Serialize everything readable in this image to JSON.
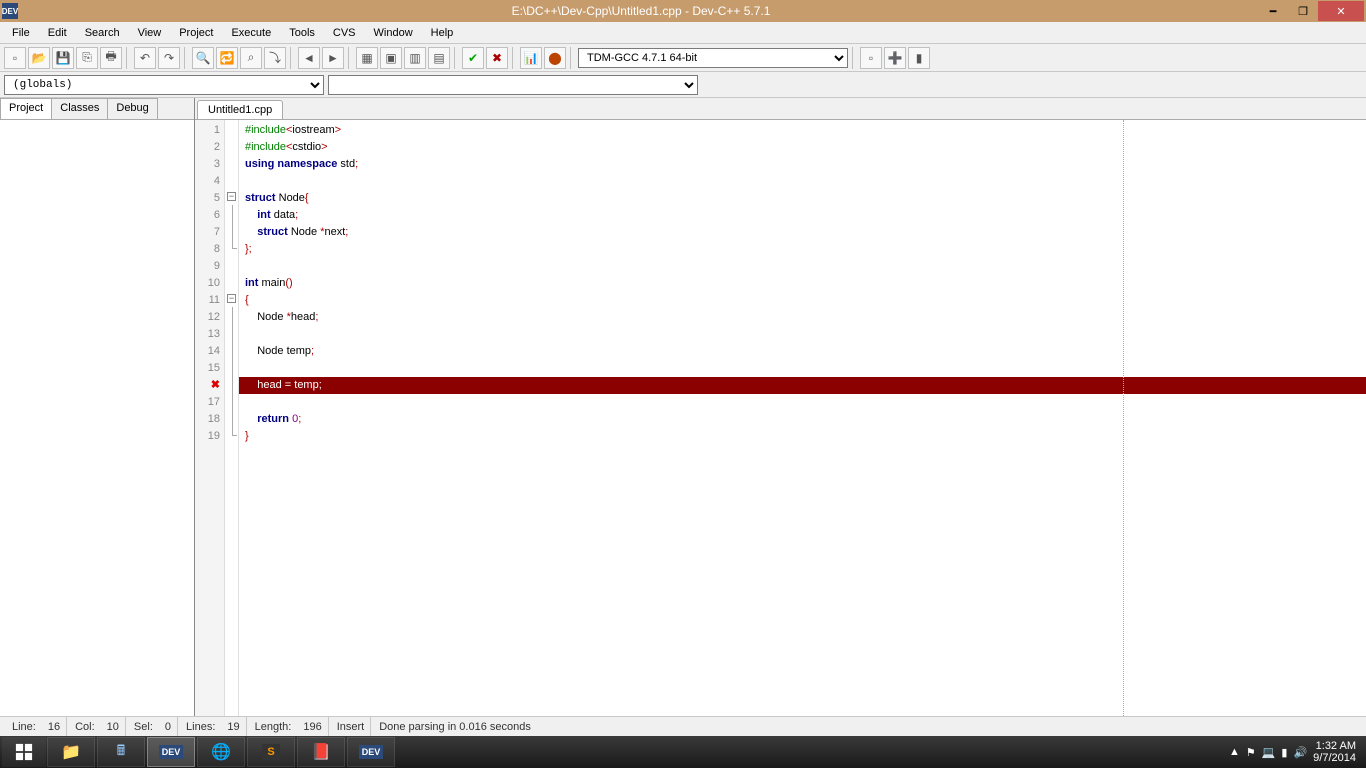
{
  "title": "E:\\DC++\\Dev-Cpp\\Untitled1.cpp - Dev-C++ 5.7.1",
  "menu": [
    "File",
    "Edit",
    "Search",
    "View",
    "Project",
    "Execute",
    "Tools",
    "CVS",
    "Window",
    "Help"
  ],
  "compiler": "TDM-GCC 4.7.1 64-bit",
  "scope": "(globals)",
  "sidetabs": [
    "Project",
    "Classes",
    "Debug"
  ],
  "filetab": "Untitled1.cpp",
  "code": {
    "lines": [
      {
        "n": "1",
        "t": [
          [
            "kw-green",
            "#include"
          ],
          [
            "sym",
            "<"
          ],
          [
            "plain",
            "iostream"
          ],
          [
            "sym",
            ">"
          ]
        ]
      },
      {
        "n": "2",
        "t": [
          [
            "kw-green",
            "#include"
          ],
          [
            "sym",
            "<"
          ],
          [
            "plain",
            "cstdio"
          ],
          [
            "sym",
            ">"
          ]
        ]
      },
      {
        "n": "3",
        "t": [
          [
            "kw-blue",
            "using"
          ],
          [
            "plain",
            " "
          ],
          [
            "kw-blue",
            "namespace"
          ],
          [
            "plain",
            " std"
          ],
          [
            "sym",
            ";"
          ]
        ]
      },
      {
        "n": "4",
        "t": []
      },
      {
        "n": "5",
        "t": [
          [
            "kw-blue",
            "struct"
          ],
          [
            "plain",
            " Node"
          ],
          [
            "sym",
            "{"
          ]
        ],
        "fold": "open"
      },
      {
        "n": "6",
        "t": [
          [
            "plain",
            "    "
          ],
          [
            "kw-blue",
            "int"
          ],
          [
            "plain",
            " data"
          ],
          [
            "sym",
            ";"
          ]
        ],
        "fold": "line"
      },
      {
        "n": "7",
        "t": [
          [
            "plain",
            "    "
          ],
          [
            "kw-blue",
            "struct"
          ],
          [
            "plain",
            " Node "
          ],
          [
            "sym",
            "*"
          ],
          [
            "plain",
            "next"
          ],
          [
            "sym",
            ";"
          ]
        ],
        "fold": "line"
      },
      {
        "n": "8",
        "t": [
          [
            "sym",
            "};"
          ]
        ],
        "fold": "end"
      },
      {
        "n": "9",
        "t": []
      },
      {
        "n": "10",
        "t": [
          [
            "kw-blue",
            "int"
          ],
          [
            "plain",
            " main"
          ],
          [
            "sym",
            "()"
          ]
        ]
      },
      {
        "n": "11",
        "t": [
          [
            "sym",
            "{"
          ]
        ],
        "fold": "open"
      },
      {
        "n": "12",
        "t": [
          [
            "plain",
            "    Node "
          ],
          [
            "sym",
            "*"
          ],
          [
            "plain",
            "head"
          ],
          [
            "sym",
            ";"
          ]
        ],
        "fold": "line"
      },
      {
        "n": "13",
        "t": [],
        "fold": "line"
      },
      {
        "n": "14",
        "t": [
          [
            "plain",
            "    Node temp"
          ],
          [
            "sym",
            ";"
          ]
        ],
        "fold": "line"
      },
      {
        "n": "15",
        "t": [],
        "fold": "line"
      },
      {
        "n": "16",
        "err": true,
        "t": [
          [
            "plain",
            "    head "
          ],
          [
            "sym",
            "="
          ],
          [
            "plain",
            " temp"
          ],
          [
            "sym",
            ";"
          ]
        ],
        "fold": "line"
      },
      {
        "n": "17",
        "t": [],
        "fold": "line"
      },
      {
        "n": "18",
        "t": [
          [
            "plain",
            "    "
          ],
          [
            "kw-blue",
            "return"
          ],
          [
            "plain",
            " "
          ],
          [
            "num",
            "0"
          ],
          [
            "sym",
            ";"
          ]
        ],
        "fold": "line"
      },
      {
        "n": "19",
        "t": [
          [
            "sym",
            "}"
          ]
        ],
        "fold": "end"
      }
    ]
  },
  "status": {
    "line_lbl": "Line:",
    "line": "16",
    "col_lbl": "Col:",
    "col": "10",
    "sel_lbl": "Sel:",
    "sel": "0",
    "lines_lbl": "Lines:",
    "lines": "19",
    "len_lbl": "Length:",
    "len": "196",
    "mode": "Insert",
    "parse": "Done parsing in 0.016 seconds"
  },
  "clock": {
    "time": "1:32 AM",
    "date": "9/7/2014"
  }
}
